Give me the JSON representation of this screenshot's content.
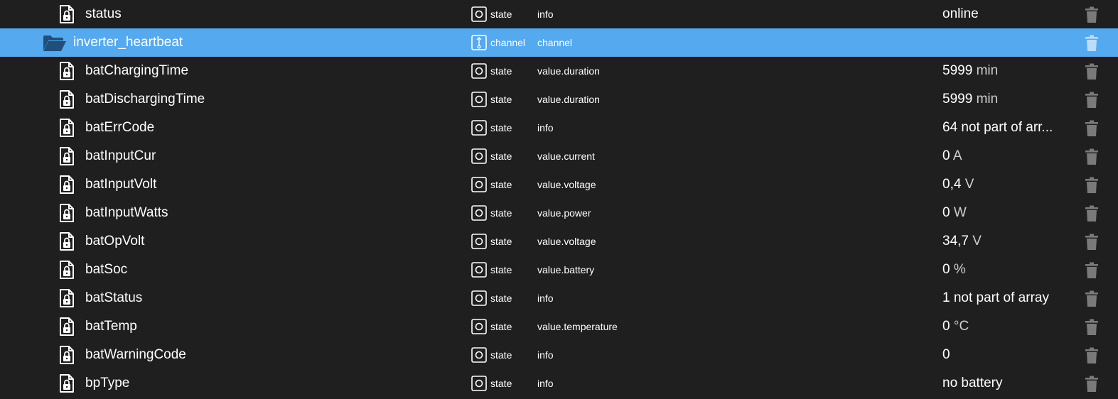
{
  "colors": {
    "background": "#1f1f1f",
    "selected_row": "#55a9ee",
    "text": "#ffffff",
    "delete_icon": "#7a7a7a",
    "delete_icon_selected": "#bcdcf7"
  },
  "rows": [
    {
      "kind": "state",
      "icon": "locked-file-icon",
      "name": "status",
      "type": "state",
      "type_icon": "state-icon",
      "role": "info",
      "value": "online",
      "unit": ""
    },
    {
      "kind": "channel",
      "icon": "folder-open-icon",
      "name": "inverter_heartbeat",
      "type": "channel",
      "type_icon": "channel-icon",
      "role": "channel",
      "value": "",
      "unit": "",
      "selected": true
    },
    {
      "kind": "state",
      "icon": "locked-file-icon",
      "name": "batChargingTime",
      "type": "state",
      "type_icon": "state-icon",
      "role": "value.duration",
      "value": "5999",
      "unit": "min"
    },
    {
      "kind": "state",
      "icon": "locked-file-icon",
      "name": "batDischargingTime",
      "type": "state",
      "type_icon": "state-icon",
      "role": "value.duration",
      "value": "5999",
      "unit": "min"
    },
    {
      "kind": "state",
      "icon": "locked-file-icon",
      "name": "batErrCode",
      "type": "state",
      "type_icon": "state-icon",
      "role": "info",
      "value": "64 not part of arr...",
      "unit": ""
    },
    {
      "kind": "state",
      "icon": "locked-file-icon",
      "name": "batInputCur",
      "type": "state",
      "type_icon": "state-icon",
      "role": "value.current",
      "value": "0",
      "unit": "A"
    },
    {
      "kind": "state",
      "icon": "locked-file-icon",
      "name": "batInputVolt",
      "type": "state",
      "type_icon": "state-icon",
      "role": "value.voltage",
      "value": "0,4",
      "unit": "V"
    },
    {
      "kind": "state",
      "icon": "locked-file-icon",
      "name": "batInputWatts",
      "type": "state",
      "type_icon": "state-icon",
      "role": "value.power",
      "value": "0",
      "unit": "W"
    },
    {
      "kind": "state",
      "icon": "locked-file-icon",
      "name": "batOpVolt",
      "type": "state",
      "type_icon": "state-icon",
      "role": "value.voltage",
      "value": "34,7",
      "unit": "V"
    },
    {
      "kind": "state",
      "icon": "locked-file-icon",
      "name": "batSoc",
      "type": "state",
      "type_icon": "state-icon",
      "role": "value.battery",
      "value": "0",
      "unit": "%"
    },
    {
      "kind": "state",
      "icon": "locked-file-icon",
      "name": "batStatus",
      "type": "state",
      "type_icon": "state-icon",
      "role": "info",
      "value": "1 not part of array",
      "unit": ""
    },
    {
      "kind": "state",
      "icon": "locked-file-icon",
      "name": "batTemp",
      "type": "state",
      "type_icon": "state-icon",
      "role": "value.temperature",
      "value": "0",
      "unit": "°C"
    },
    {
      "kind": "state",
      "icon": "locked-file-icon",
      "name": "batWarningCode",
      "type": "state",
      "type_icon": "state-icon",
      "role": "info",
      "value": "0",
      "unit": ""
    },
    {
      "kind": "state",
      "icon": "locked-file-icon",
      "name": "bpType",
      "type": "state",
      "type_icon": "state-icon",
      "role": "info",
      "value": "no battery",
      "unit": ""
    }
  ]
}
